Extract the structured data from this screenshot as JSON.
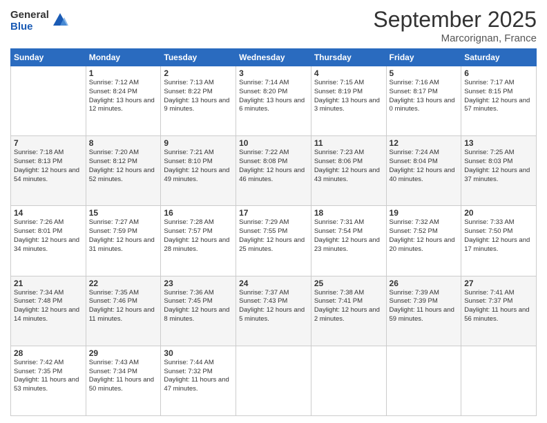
{
  "logo": {
    "general": "General",
    "blue": "Blue"
  },
  "title": "September 2025",
  "subtitle": "Marcorignan, France",
  "weekdays": [
    "Sunday",
    "Monday",
    "Tuesday",
    "Wednesday",
    "Thursday",
    "Friday",
    "Saturday"
  ],
  "weeks": [
    [
      {
        "day": "",
        "sunrise": "",
        "sunset": "",
        "daylight": ""
      },
      {
        "day": "1",
        "sunrise": "Sunrise: 7:12 AM",
        "sunset": "Sunset: 8:24 PM",
        "daylight": "Daylight: 13 hours and 12 minutes."
      },
      {
        "day": "2",
        "sunrise": "Sunrise: 7:13 AM",
        "sunset": "Sunset: 8:22 PM",
        "daylight": "Daylight: 13 hours and 9 minutes."
      },
      {
        "day": "3",
        "sunrise": "Sunrise: 7:14 AM",
        "sunset": "Sunset: 8:20 PM",
        "daylight": "Daylight: 13 hours and 6 minutes."
      },
      {
        "day": "4",
        "sunrise": "Sunrise: 7:15 AM",
        "sunset": "Sunset: 8:19 PM",
        "daylight": "Daylight: 13 hours and 3 minutes."
      },
      {
        "day": "5",
        "sunrise": "Sunrise: 7:16 AM",
        "sunset": "Sunset: 8:17 PM",
        "daylight": "Daylight: 13 hours and 0 minutes."
      },
      {
        "day": "6",
        "sunrise": "Sunrise: 7:17 AM",
        "sunset": "Sunset: 8:15 PM",
        "daylight": "Daylight: 12 hours and 57 minutes."
      }
    ],
    [
      {
        "day": "7",
        "sunrise": "Sunrise: 7:18 AM",
        "sunset": "Sunset: 8:13 PM",
        "daylight": "Daylight: 12 hours and 54 minutes."
      },
      {
        "day": "8",
        "sunrise": "Sunrise: 7:20 AM",
        "sunset": "Sunset: 8:12 PM",
        "daylight": "Daylight: 12 hours and 52 minutes."
      },
      {
        "day": "9",
        "sunrise": "Sunrise: 7:21 AM",
        "sunset": "Sunset: 8:10 PM",
        "daylight": "Daylight: 12 hours and 49 minutes."
      },
      {
        "day": "10",
        "sunrise": "Sunrise: 7:22 AM",
        "sunset": "Sunset: 8:08 PM",
        "daylight": "Daylight: 12 hours and 46 minutes."
      },
      {
        "day": "11",
        "sunrise": "Sunrise: 7:23 AM",
        "sunset": "Sunset: 8:06 PM",
        "daylight": "Daylight: 12 hours and 43 minutes."
      },
      {
        "day": "12",
        "sunrise": "Sunrise: 7:24 AM",
        "sunset": "Sunset: 8:04 PM",
        "daylight": "Daylight: 12 hours and 40 minutes."
      },
      {
        "day": "13",
        "sunrise": "Sunrise: 7:25 AM",
        "sunset": "Sunset: 8:03 PM",
        "daylight": "Daylight: 12 hours and 37 minutes."
      }
    ],
    [
      {
        "day": "14",
        "sunrise": "Sunrise: 7:26 AM",
        "sunset": "Sunset: 8:01 PM",
        "daylight": "Daylight: 12 hours and 34 minutes."
      },
      {
        "day": "15",
        "sunrise": "Sunrise: 7:27 AM",
        "sunset": "Sunset: 7:59 PM",
        "daylight": "Daylight: 12 hours and 31 minutes."
      },
      {
        "day": "16",
        "sunrise": "Sunrise: 7:28 AM",
        "sunset": "Sunset: 7:57 PM",
        "daylight": "Daylight: 12 hours and 28 minutes."
      },
      {
        "day": "17",
        "sunrise": "Sunrise: 7:29 AM",
        "sunset": "Sunset: 7:55 PM",
        "daylight": "Daylight: 12 hours and 25 minutes."
      },
      {
        "day": "18",
        "sunrise": "Sunrise: 7:31 AM",
        "sunset": "Sunset: 7:54 PM",
        "daylight": "Daylight: 12 hours and 23 minutes."
      },
      {
        "day": "19",
        "sunrise": "Sunrise: 7:32 AM",
        "sunset": "Sunset: 7:52 PM",
        "daylight": "Daylight: 12 hours and 20 minutes."
      },
      {
        "day": "20",
        "sunrise": "Sunrise: 7:33 AM",
        "sunset": "Sunset: 7:50 PM",
        "daylight": "Daylight: 12 hours and 17 minutes."
      }
    ],
    [
      {
        "day": "21",
        "sunrise": "Sunrise: 7:34 AM",
        "sunset": "Sunset: 7:48 PM",
        "daylight": "Daylight: 12 hours and 14 minutes."
      },
      {
        "day": "22",
        "sunrise": "Sunrise: 7:35 AM",
        "sunset": "Sunset: 7:46 PM",
        "daylight": "Daylight: 12 hours and 11 minutes."
      },
      {
        "day": "23",
        "sunrise": "Sunrise: 7:36 AM",
        "sunset": "Sunset: 7:45 PM",
        "daylight": "Daylight: 12 hours and 8 minutes."
      },
      {
        "day": "24",
        "sunrise": "Sunrise: 7:37 AM",
        "sunset": "Sunset: 7:43 PM",
        "daylight": "Daylight: 12 hours and 5 minutes."
      },
      {
        "day": "25",
        "sunrise": "Sunrise: 7:38 AM",
        "sunset": "Sunset: 7:41 PM",
        "daylight": "Daylight: 12 hours and 2 minutes."
      },
      {
        "day": "26",
        "sunrise": "Sunrise: 7:39 AM",
        "sunset": "Sunset: 7:39 PM",
        "daylight": "Daylight: 11 hours and 59 minutes."
      },
      {
        "day": "27",
        "sunrise": "Sunrise: 7:41 AM",
        "sunset": "Sunset: 7:37 PM",
        "daylight": "Daylight: 11 hours and 56 minutes."
      }
    ],
    [
      {
        "day": "28",
        "sunrise": "Sunrise: 7:42 AM",
        "sunset": "Sunset: 7:35 PM",
        "daylight": "Daylight: 11 hours and 53 minutes."
      },
      {
        "day": "29",
        "sunrise": "Sunrise: 7:43 AM",
        "sunset": "Sunset: 7:34 PM",
        "daylight": "Daylight: 11 hours and 50 minutes."
      },
      {
        "day": "30",
        "sunrise": "Sunrise: 7:44 AM",
        "sunset": "Sunset: 7:32 PM",
        "daylight": "Daylight: 11 hours and 47 minutes."
      },
      {
        "day": "",
        "sunrise": "",
        "sunset": "",
        "daylight": ""
      },
      {
        "day": "",
        "sunrise": "",
        "sunset": "",
        "daylight": ""
      },
      {
        "day": "",
        "sunrise": "",
        "sunset": "",
        "daylight": ""
      },
      {
        "day": "",
        "sunrise": "",
        "sunset": "",
        "daylight": ""
      }
    ]
  ]
}
